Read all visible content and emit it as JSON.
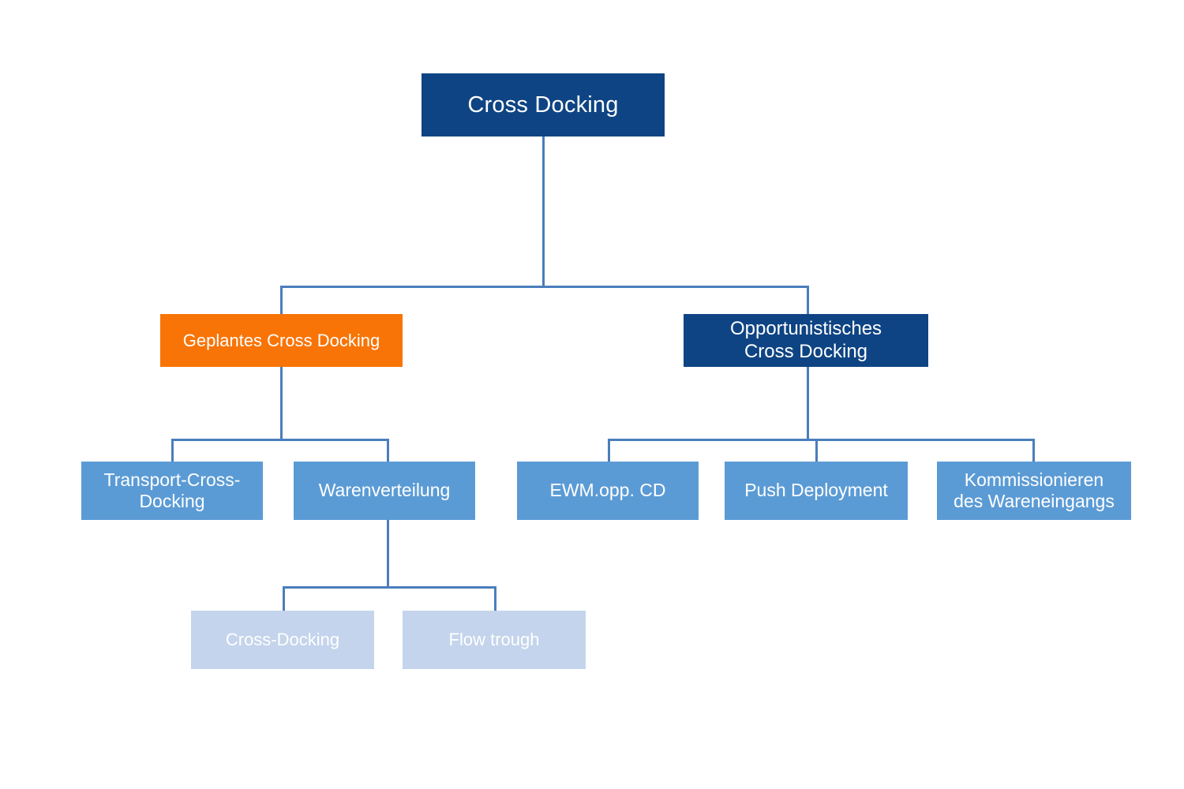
{
  "diagram": {
    "title": "Cross Docking",
    "type": "hierarchy-tree",
    "colors": {
      "root": "#0E4483",
      "planned": "#F87406",
      "opportunistic": "#0E4483",
      "level3": "#5B9BD5",
      "level4": "#C4D4EC",
      "connector": "#4A7EBB",
      "background": "#FFFFFF",
      "text": "#FFFFFF"
    },
    "nodes": {
      "root": {
        "label": "Cross Docking"
      },
      "planned": {
        "label": "Geplantes Cross Docking"
      },
      "opportunistic": {
        "label_line1": "Opportunistisches",
        "label_line2": "Cross Docking"
      },
      "transport_cd": {
        "label_line1": "Transport-Cross-",
        "label_line2": "Docking"
      },
      "warenverteilung": {
        "label": "Warenverteilung"
      },
      "ewm_opp_cd": {
        "label": "EWM.opp. CD"
      },
      "push_deployment": {
        "label": "Push Deployment"
      },
      "kommissionieren": {
        "label_line1": "Kommissionieren",
        "label_line2": "des Wareneingangs"
      },
      "cross_docking_leaf": {
        "label": "Cross-Docking"
      },
      "flow_trough_leaf": {
        "label": "Flow trough"
      }
    }
  }
}
